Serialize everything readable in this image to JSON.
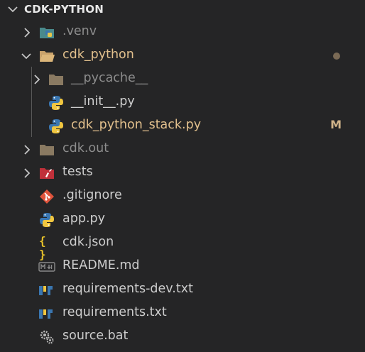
{
  "explorer": {
    "title": "CDK-PYTHON",
    "items": [
      {
        "label": ".venv",
        "icon": "venv-folder-icon",
        "color": "#8d8d8d"
      },
      {
        "label": "cdk_python",
        "icon": "folder-open-icon",
        "color": "#e2c08d"
      },
      {
        "label": "__pycache__",
        "icon": "folder-icon",
        "color": "#8d8d8d"
      },
      {
        "label": "__init__.py",
        "icon": "python-icon",
        "color": "#cccccc"
      },
      {
        "label": "cdk_python_stack.py",
        "icon": "python-icon",
        "color": "#e2c08d",
        "badge": "M"
      },
      {
        "label": "cdk.out",
        "icon": "folder-icon",
        "color": "#8d8d8d"
      },
      {
        "label": "tests",
        "icon": "test-folder-icon",
        "color": "#cccccc"
      },
      {
        "label": ".gitignore",
        "icon": "git-icon",
        "color": "#cccccc"
      },
      {
        "label": "app.py",
        "icon": "python-icon",
        "color": "#cccccc"
      },
      {
        "label": "cdk.json",
        "icon": "json-braces-icon",
        "color": "#cccccc"
      },
      {
        "label": "README.md",
        "icon": "markdown-icon",
        "color": "#cccccc"
      },
      {
        "label": "requirements-dev.txt",
        "icon": "pip-requirements-icon",
        "color": "#cccccc"
      },
      {
        "label": "requirements.txt",
        "icon": "pip-requirements-icon",
        "color": "#cccccc"
      },
      {
        "label": "source.bat",
        "icon": "gears-icon",
        "color": "#cccccc"
      }
    ]
  },
  "colors": {
    "background": "#252526",
    "modified": "#e2c08d",
    "ignored": "#8d8d8d",
    "default_text": "#cccccc",
    "modified_dot": "#7a6a55"
  }
}
